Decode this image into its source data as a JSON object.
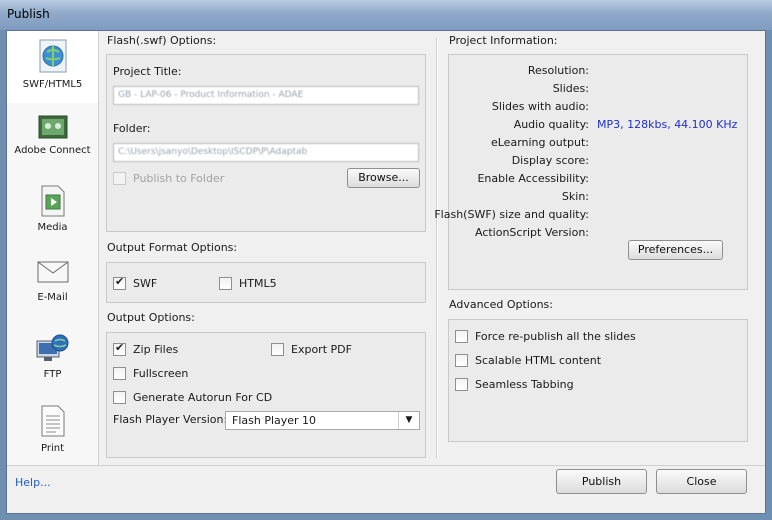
{
  "window": {
    "title": "Publish"
  },
  "sidebar": {
    "items": [
      {
        "label": "SWF/HTML5",
        "icon": "swf-html5-icon",
        "selected": true
      },
      {
        "label": "Adobe Connect",
        "icon": "adobe-connect-icon",
        "selected": false
      },
      {
        "label": "Media",
        "icon": "media-icon",
        "selected": false
      },
      {
        "label": "E-Mail",
        "icon": "email-icon",
        "selected": false
      },
      {
        "label": "FTP",
        "icon": "ftp-icon",
        "selected": false
      },
      {
        "label": "Print",
        "icon": "print-icon",
        "selected": false
      }
    ]
  },
  "flash_options": {
    "heading": "Flash(.swf) Options:",
    "project_title_label": "Project Title:",
    "project_title_value": "GB - LAP-06 - Product Information - ADAE",
    "folder_label": "Folder:",
    "folder_value": "C:\\Users\\jsanyo\\Desktop\\ISCDP\\P\\Adaptab",
    "publish_to_folder_label": "Publish to Folder",
    "publish_to_folder_checked": false,
    "browse_label": "Browse..."
  },
  "output_format": {
    "heading": "Output Format Options:",
    "swf_label": "SWF",
    "swf_checked": true,
    "html5_label": "HTML5",
    "html5_checked": false
  },
  "output_options": {
    "heading": "Output Options:",
    "zip_label": "Zip Files",
    "zip_checked": true,
    "export_pdf_label": "Export PDF",
    "export_pdf_checked": false,
    "fullscreen_label": "Fullscreen",
    "fullscreen_checked": false,
    "autorun_label": "Generate Autorun For CD",
    "autorun_checked": false,
    "flash_player_label": "Flash Player Version:",
    "flash_player_value": "Flash Player 10"
  },
  "project_info": {
    "heading": "Project Information:",
    "rows": [
      {
        "label": "Resolution:",
        "value": ""
      },
      {
        "label": "Slides:",
        "value": ""
      },
      {
        "label": "Slides with audio:",
        "value": ""
      },
      {
        "label": "Audio quality:",
        "value": "MP3, 128kbs, 44.100 KHz"
      },
      {
        "label": "eLearning output:",
        "value": ""
      },
      {
        "label": "Display score:",
        "value": ""
      },
      {
        "label": "Enable Accessibility:",
        "value": ""
      },
      {
        "label": "Skin:",
        "value": ""
      },
      {
        "label": "Flash(SWF) size and quality:",
        "value": ""
      },
      {
        "label": "ActionScript Version:",
        "value": ""
      }
    ],
    "preferences_label": "Preferences..."
  },
  "advanced_options": {
    "heading": "Advanced Options:",
    "items": [
      {
        "label": "Force re-publish all the slides",
        "checked": false
      },
      {
        "label": "Scalable HTML content",
        "checked": false
      },
      {
        "label": "Seamless Tabbing",
        "checked": false
      }
    ]
  },
  "footer": {
    "help_label": "Help...",
    "publish_label": "Publish",
    "close_label": "Close"
  }
}
